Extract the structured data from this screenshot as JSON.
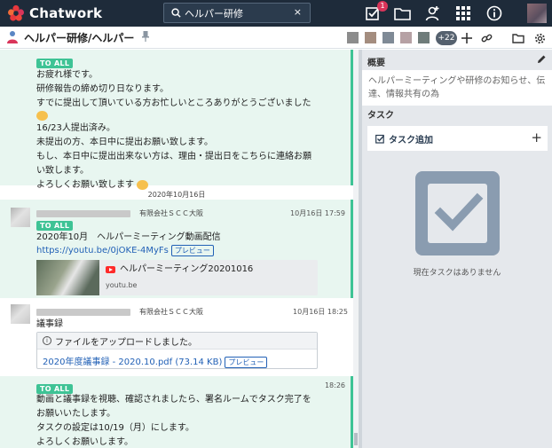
{
  "app": {
    "name": "Chatwork"
  },
  "search": {
    "value": "ヘルパー研修",
    "clear": "×"
  },
  "topbar": {
    "task_badge": "1"
  },
  "room": {
    "title": "ヘルパー研修/ヘルパー",
    "member_count": "+22"
  },
  "colors": {
    "nav_bg": "#1e2b3a",
    "accent_green": "#3ec395",
    "link_blue": "#2261b6",
    "badge_red": "#d9355a"
  },
  "messages": [
    {
      "tag": "TO ALL",
      "lines": [
        "お疲れ様です。",
        "研修報告の締め切り日なります。",
        "すでに提出して頂いている方お忙しいところありがとうございました",
        "16/23人提出済み。",
        "未提出の方、本日中に提出お願い致します。",
        "もし、本日中に提出出来ない方は、理由・提出日をこちらに連絡お願",
        "い致します。",
        "よろしくお願い致します"
      ]
    },
    {
      "company": "有限会社ＳＣＣ大阪",
      "time": "10月16日 17:59",
      "tag": "TO ALL",
      "title": "2020年10月　ヘルパーミーティング動画配信",
      "link": "https://youtu.be/0jOKE-4MyFs",
      "preview": "プレビュー",
      "card_title": "ヘルパーミーティング20201016",
      "card_domain": "youtu.be"
    },
    {
      "company": "有限会社ＳＣＣ大阪",
      "time": "10月16日 18:25",
      "title": "議事録",
      "file_notice": "ファイルをアップロードしました。",
      "file_link": "2020年度議事録 - 2020.10.pdf (73.14 KB)",
      "preview": "プレビュー"
    },
    {
      "time": "18:26",
      "tag": "TO ALL",
      "lines": [
        "動画と議事録を視聴、確認されましたら、署名ルームでタスク完了を",
        "お願いいたします。",
        "タスクの設定は10/19（月）にします。",
        "よろしくお願いします。"
      ]
    }
  ],
  "date_separator": "2020年10月16日",
  "side_panel": {
    "summary_title": "概要",
    "summary_text_1": "ヘルパーミーティングや研修のお知らせ、伝",
    "summary_text_2": "達、情報共有の為",
    "task_title": "タスク",
    "add_task_label": "タスク追加",
    "empty_text": "現在タスクはありません"
  }
}
